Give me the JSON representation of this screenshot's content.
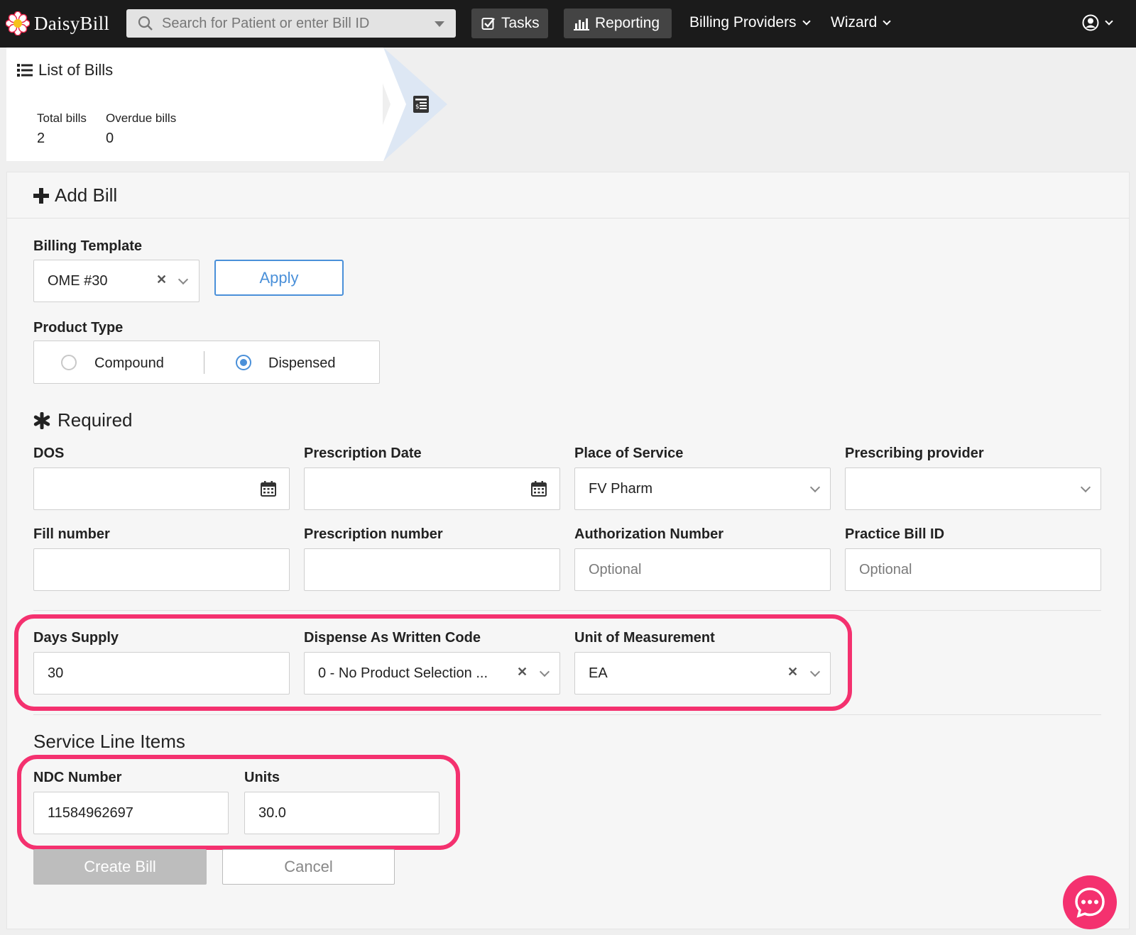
{
  "nav": {
    "logo_text": "DaisyBill",
    "search_placeholder": "Search for Patient or enter Bill ID",
    "tasks_label": "Tasks",
    "reporting_label": "Reporting",
    "billing_providers_label": "Billing Providers",
    "wizard_label": "Wizard"
  },
  "bills_summary": {
    "title": "List of Bills",
    "total_label": "Total bills",
    "total_value": "2",
    "overdue_label": "Overdue bills",
    "overdue_value": "0"
  },
  "form": {
    "title": "Add Bill",
    "billing_template": {
      "label": "Billing Template",
      "value": "OME #30",
      "apply_label": "Apply"
    },
    "product_type": {
      "label": "Product Type",
      "options": [
        "Compound",
        "Dispensed"
      ],
      "selected": "Dispensed"
    },
    "required_title": "Required",
    "dos": {
      "label": "DOS",
      "value": ""
    },
    "prescription_date": {
      "label": "Prescription Date",
      "value": ""
    },
    "place_of_service": {
      "label": "Place of Service",
      "value": "FV Pharm"
    },
    "prescribing_provider": {
      "label": "Prescribing provider",
      "value": ""
    },
    "fill_number": {
      "label": "Fill number",
      "value": ""
    },
    "prescription_number": {
      "label": "Prescription number",
      "value": ""
    },
    "authorization_number": {
      "label": "Authorization Number",
      "placeholder": "Optional"
    },
    "practice_bill_id": {
      "label": "Practice Bill ID",
      "placeholder": "Optional"
    },
    "days_supply": {
      "label": "Days Supply",
      "value": "30"
    },
    "daw_code": {
      "label": "Dispense As Written Code",
      "value": "0 - No Product Selection ..."
    },
    "unit_of_measurement": {
      "label": "Unit of Measurement",
      "value": "EA"
    },
    "service_line_items_title": "Service Line Items",
    "ndc_number": {
      "label": "NDC Number",
      "value": "11584962697"
    },
    "units": {
      "label": "Units",
      "value": "30.0"
    },
    "create_label": "Create Bill",
    "cancel_label": "Cancel"
  },
  "colors": {
    "nav_bg": "#1b1b1b",
    "accent_blue": "#4a90d9",
    "highlight_pink": "#f4316f",
    "logo_red": "#e8254a"
  }
}
